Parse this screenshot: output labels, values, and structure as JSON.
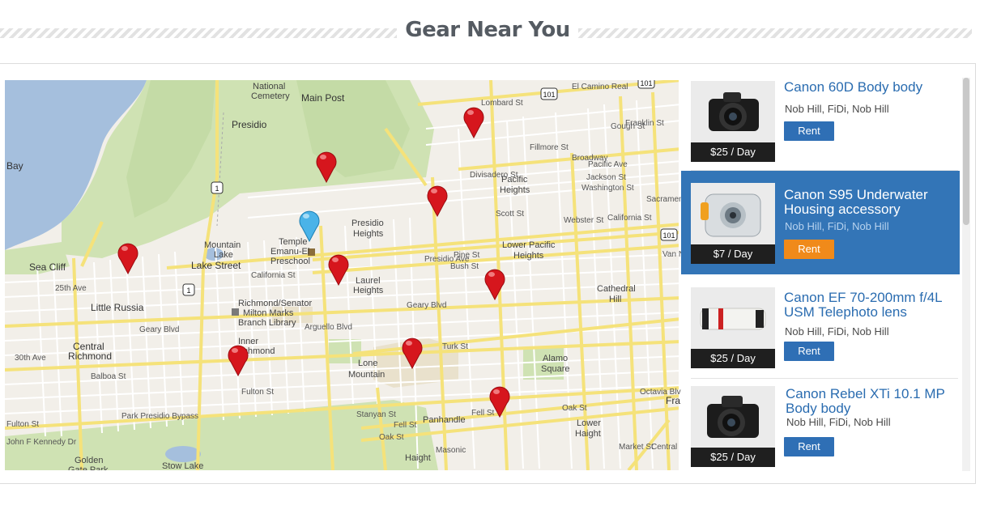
{
  "header": {
    "title": "Gear Near You"
  },
  "map": {
    "labels": [
      {
        "text": "National",
        "cls": "",
        "pos": "left:306px;top:2px"
      },
      {
        "text": "Cemetery",
        "cls": "",
        "pos": "left:304px;top:14px"
      },
      {
        "text": "Main Post",
        "cls": "big",
        "pos": "left:366px;top:16px"
      },
      {
        "text": "Presidio",
        "cls": "big",
        "pos": "left:280px;top:49px"
      },
      {
        "text": "Bay",
        "cls": "big",
        "pos": "left:2px;top:100px"
      },
      {
        "text": "Presidio",
        "cls": "",
        "pos": "left:428px;top:171px"
      },
      {
        "text": "Heights",
        "cls": "",
        "pos": "left:430px;top:184px"
      },
      {
        "text": "Temple",
        "cls": "",
        "pos": "left:338px;top:194px"
      },
      {
        "text": "Emanu-El",
        "cls": "",
        "pos": "left:328px;top:206px"
      },
      {
        "text": "Preschool",
        "cls": "",
        "pos": "left:328px;top:218px"
      },
      {
        "text": "Mountain",
        "cls": "",
        "pos": "left:246px;top:198px"
      },
      {
        "text": "Lake",
        "cls": "",
        "pos": "left:258px;top:210px"
      },
      {
        "text": "Sea Cliff",
        "cls": "big",
        "pos": "left:30px;top:225px"
      },
      {
        "text": "Lake Street",
        "cls": "big",
        "pos": "left:230px;top:223px"
      },
      {
        "text": "California St",
        "cls": "street",
        "pos": "left:304px;top:236px"
      },
      {
        "text": "Laurel",
        "cls": "",
        "pos": "left:433px;top:242px"
      },
      {
        "text": "Heights",
        "cls": "",
        "pos": "left:430px;top:254px"
      },
      {
        "text": "Pacific",
        "cls": "",
        "pos": "left:613px;top:117px"
      },
      {
        "text": "Heights",
        "cls": "",
        "pos": "left:611px;top:130px"
      },
      {
        "text": "Lower Pacific",
        "cls": "",
        "pos": "left:614px;top:198px"
      },
      {
        "text": "Heights",
        "cls": "",
        "pos": "left:628px;top:211px"
      },
      {
        "text": "Cathedral",
        "cls": "",
        "pos": "left:731px;top:252px"
      },
      {
        "text": "Hill",
        "cls": "",
        "pos": "left:746px;top:265px"
      },
      {
        "text": "Little Russia",
        "cls": "big",
        "pos": "left:106px;top:275px"
      },
      {
        "text": "Richmond/Senator",
        "cls": "",
        "pos": "left:288px;top:270px"
      },
      {
        "text": "Milton Marks",
        "cls": "",
        "pos": "left:294px;top:282px"
      },
      {
        "text": "Branch Library",
        "cls": "",
        "pos": "left:288px;top:294px"
      },
      {
        "text": "Geary Blvd",
        "cls": "street",
        "pos": "left:166px;top:303px"
      },
      {
        "text": "Central",
        "cls": "big",
        "pos": "left:84px;top:323px"
      },
      {
        "text": "Richmond",
        "cls": "big",
        "pos": "left:78px;top:335px"
      },
      {
        "text": "Inner",
        "cls": "",
        "pos": "left:288px;top:317px"
      },
      {
        "text": "Richmond",
        "cls": "",
        "pos": "left:284px;top:329px"
      },
      {
        "text": "Lone",
        "cls": "",
        "pos": "left:436px;top:344px"
      },
      {
        "text": "Mountain",
        "cls": "",
        "pos": "left:424px;top:358px"
      },
      {
        "text": "Alamo",
        "cls": "",
        "pos": "left:664px;top:338px"
      },
      {
        "text": "Square",
        "cls": "",
        "pos": "left:662px;top:351px"
      },
      {
        "text": "Balboa St",
        "cls": "street",
        "pos": "left:106px;top:361px"
      },
      {
        "text": "Fulton St",
        "cls": "street",
        "pos": "left:292px;top:380px"
      },
      {
        "text": "Panhandle",
        "cls": "",
        "pos": "left:516px;top:414px"
      },
      {
        "text": "Lower",
        "cls": "",
        "pos": "left:706px;top:418px"
      },
      {
        "text": "Haight",
        "cls": "",
        "pos": "left:704px;top:431px"
      },
      {
        "text": "Golden",
        "cls": "",
        "pos": "left:86px;top:464px"
      },
      {
        "text": "Gate Park",
        "cls": "",
        "pos": "left:78px;top:476px"
      },
      {
        "text": "Haight",
        "cls": "",
        "pos": "left:494px;top:461px"
      },
      {
        "text": "Stow Lake",
        "cls": "",
        "pos": "left:194px;top:471px"
      },
      {
        "text": "Fra",
        "cls": "big",
        "pos": "left:816px;top:390px"
      },
      {
        "text": "El Camino Real",
        "cls": "street",
        "pos": "left:700px;top:3px"
      },
      {
        "text": "Lombard St",
        "cls": "street",
        "pos": "left:588px;top:23px"
      },
      {
        "text": "Broadway",
        "cls": "street",
        "pos": "left:700px;top:91px"
      },
      {
        "text": "Pacific Ave",
        "cls": "street",
        "pos": "left:720px;top:99px"
      },
      {
        "text": "Jackson St",
        "cls": "street",
        "pos": "left:718px;top:115px"
      },
      {
        "text": "Washington St",
        "cls": "street",
        "pos": "left:712px;top:128px"
      },
      {
        "text": "Sacrament",
        "cls": "street",
        "pos": "left:792px;top:142px"
      },
      {
        "text": "California St",
        "cls": "street",
        "pos": "left:744px;top:165px"
      },
      {
        "text": "Pine St",
        "cls": "street",
        "pos": "left:554px;top:211px"
      },
      {
        "text": "Bush St",
        "cls": "street",
        "pos": "left:550px;top:225px"
      },
      {
        "text": "Geary Blvd",
        "cls": "street",
        "pos": "left:496px;top:273px"
      },
      {
        "text": "Turk St",
        "cls": "street",
        "pos": "left:540px;top:324px"
      },
      {
        "text": "Fell St",
        "cls": "street",
        "pos": "left:480px;top:421px"
      },
      {
        "text": "Oak St",
        "cls": "street",
        "pos": "left:462px;top:436px"
      },
      {
        "text": "Fell St",
        "cls": "street",
        "pos": "left:576px;top:406px"
      },
      {
        "text": "Oak St",
        "cls": "street",
        "pos": "left:688px;top:400px"
      },
      {
        "text": "Fulton St",
        "cls": "street",
        "pos": "left:2px;top:420px"
      },
      {
        "text": "John F Kennedy Dr",
        "cls": "street",
        "pos": "left:2px;top:442px"
      },
      {
        "text": "Park Presidio Bypass",
        "cls": "street",
        "pos": "left:144px;top:410px"
      },
      {
        "text": "25th Ave",
        "cls": "street",
        "pos": "left:62px;top:252px"
      },
      {
        "text": "30th Ave",
        "cls": "street",
        "pos": "left:12px;top:338px"
      },
      {
        "text": "Arguello Blvd",
        "cls": "street",
        "pos": "left:370px;top:300px"
      },
      {
        "text": "Presidio Ave",
        "cls": "street",
        "pos": "left:518px;top:216px"
      },
      {
        "text": "Divisadero St",
        "cls": "street",
        "pos": "left:574px;top:112px"
      },
      {
        "text": "Masonic",
        "cls": "street",
        "pos": "left:532px;top:452px"
      },
      {
        "text": "Stanyan St",
        "cls": "street",
        "pos": "left:434px;top:408px"
      },
      {
        "text": "Fillmore St",
        "cls": "street",
        "pos": "left:648px;top:78px"
      },
      {
        "text": "Scott St",
        "cls": "street",
        "pos": "left:606px;top:160px"
      },
      {
        "text": "Webster St",
        "cls": "street",
        "pos": "left:690px;top:168px"
      },
      {
        "text": "Gough St",
        "cls": "street",
        "pos": "left:748px;top:52px"
      },
      {
        "text": "Franklin St",
        "cls": "street",
        "pos": "left:766px;top:48px"
      },
      {
        "text": "Van Ness Ave",
        "cls": "street",
        "pos": "left:812px;top:210px"
      },
      {
        "text": "Octavia Blvd",
        "cls": "street",
        "pos": "left:784px;top:380px"
      },
      {
        "text": "Market St",
        "cls": "street",
        "pos": "left:758px;top:448px"
      },
      {
        "text": "Central",
        "cls": "street",
        "pos": "left:798px;top:448px"
      }
    ],
    "icons": [
      "pin-red",
      "pin-blue",
      "highway-shield",
      "library-icon",
      "school-icon"
    ]
  },
  "listings": [
    {
      "name": "Canon 60D Body body",
      "location": "Nob Hill, FiDi, Nob Hill",
      "price": "$25 / Day",
      "action": "Rent",
      "selected": false,
      "camera": "dslr"
    },
    {
      "name": "Canon S95 Underwater Housing accessory",
      "location": "Nob Hill, FiDi, Nob Hill",
      "price": "$7 / Day",
      "action": "Rent",
      "selected": true,
      "camera": "housing"
    },
    {
      "name": "Canon EF 70-200mm f/4L USM Telephoto lens",
      "location": "Nob Hill, FiDi, Nob Hill",
      "price": "$25 / Day",
      "action": "Rent",
      "selected": false,
      "camera": "lens"
    },
    {
      "name": "Canon Rebel XTi 10.1 MP Body body",
      "location": "Nob Hill, FiDi, Nob Hill",
      "price": "$25 / Day",
      "action": "Rent",
      "selected": false,
      "camera": "dslr2"
    }
  ],
  "colors": {
    "accent": "#3375b7",
    "rent_button": "#2f6fb5",
    "rent_selected": "#f08a1a",
    "pin_red": "#d6161d",
    "pin_blue": "#4ab3e8"
  }
}
